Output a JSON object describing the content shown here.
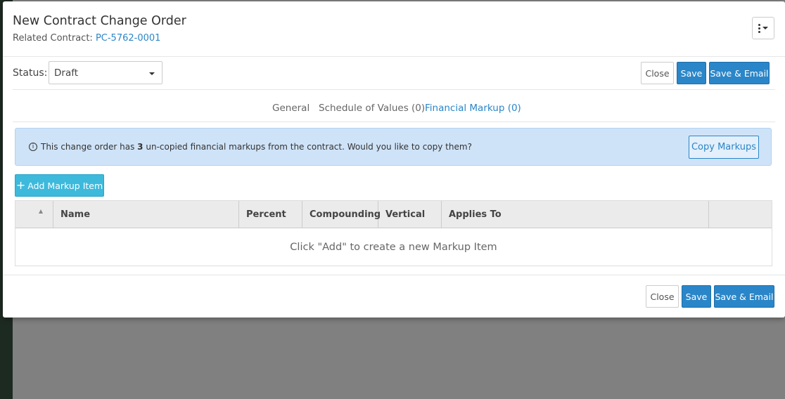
{
  "header": {
    "title": "New Contract Change Order",
    "related_label": "Related Contract:",
    "related_link": "PC-5762-0001"
  },
  "status": {
    "label": "Status:",
    "value": "Draft"
  },
  "buttons": {
    "close": "Close",
    "save": "Save",
    "save_email": "Save & Email"
  },
  "tabs": [
    {
      "label": "General",
      "active": false
    },
    {
      "label": "Schedule of Values (0)",
      "active": false
    },
    {
      "label": "Financial Markup (0)",
      "active": true
    }
  ],
  "alert": {
    "text_before": "This change order has",
    "count": "3",
    "text_after": "un-copied financial markups from the contract. Would you like to copy them?",
    "button": "Copy Markups"
  },
  "add_button": "Add Markup Item",
  "table": {
    "columns": [
      "Name",
      "Percent",
      "Compounding",
      "Vertical",
      "Applies To"
    ],
    "empty_message": "Click \"Add\" to create a new Markup Item"
  },
  "colors": {
    "primary": "#2a86c8",
    "info_bg": "#cfe3f8",
    "add_button": "#3db9dc",
    "overlay": "#808080"
  }
}
